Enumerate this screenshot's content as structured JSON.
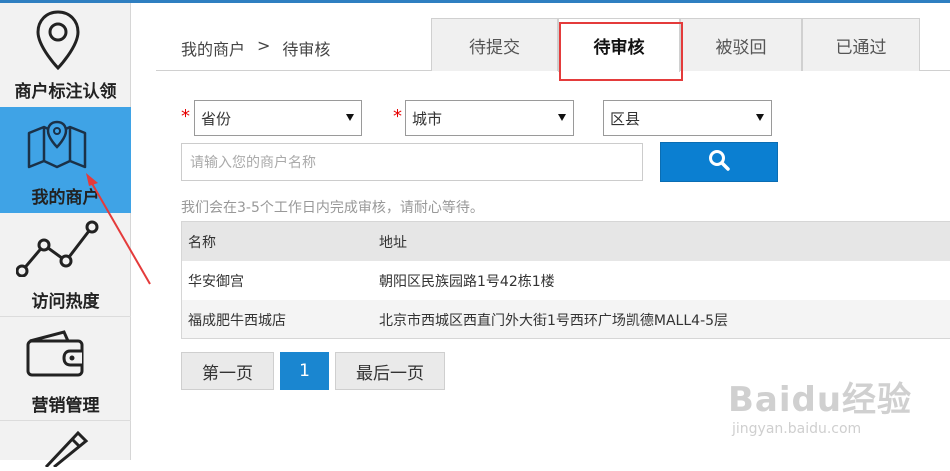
{
  "sidebar": {
    "items": [
      {
        "label": "商户标注认领",
        "icon": "map-pin-icon",
        "active": false
      },
      {
        "label": "我的商户",
        "icon": "folded-map-icon",
        "active": true
      },
      {
        "label": "访问热度",
        "icon": "line-trend-icon",
        "active": false
      },
      {
        "label": "营销管理",
        "icon": "wallet-icon",
        "active": false
      },
      {
        "label": "",
        "icon": "pencil-icon",
        "active": false
      }
    ]
  },
  "header": {
    "breadcrumb": [
      "我的商户",
      ">",
      "待审核"
    ],
    "tabs": [
      {
        "label": "待提交",
        "active": false
      },
      {
        "label": "待审核",
        "active": true
      },
      {
        "label": "被驳回",
        "active": false
      },
      {
        "label": "已通过",
        "active": false
      }
    ]
  },
  "filters": {
    "required_mark": "*",
    "province": "省份",
    "city": "城市",
    "district": "区县",
    "search_placeholder": "请输入您的商户名称",
    "hint": "我们会在3-5个工作日内完成审核，请耐心等待。"
  },
  "table": {
    "headers": [
      "名称",
      "地址"
    ],
    "rows": [
      [
        "华安御宫",
        "朝阳区民族园路1号42栋1楼"
      ],
      [
        "福成肥牛西城店",
        "北京市西城区西直门外大街1号西环广场凯德MALL4-5层"
      ]
    ]
  },
  "pagination": {
    "first": "第一页",
    "current": "1",
    "last": "最后一页"
  },
  "watermark": {
    "main": "Baidu经验",
    "sub": "jingyan.baidu.com"
  },
  "colors": {
    "accent": "#0b7fd1",
    "sidebar_active": "#3fa3e6",
    "annotation_red": "#e43b3b"
  }
}
